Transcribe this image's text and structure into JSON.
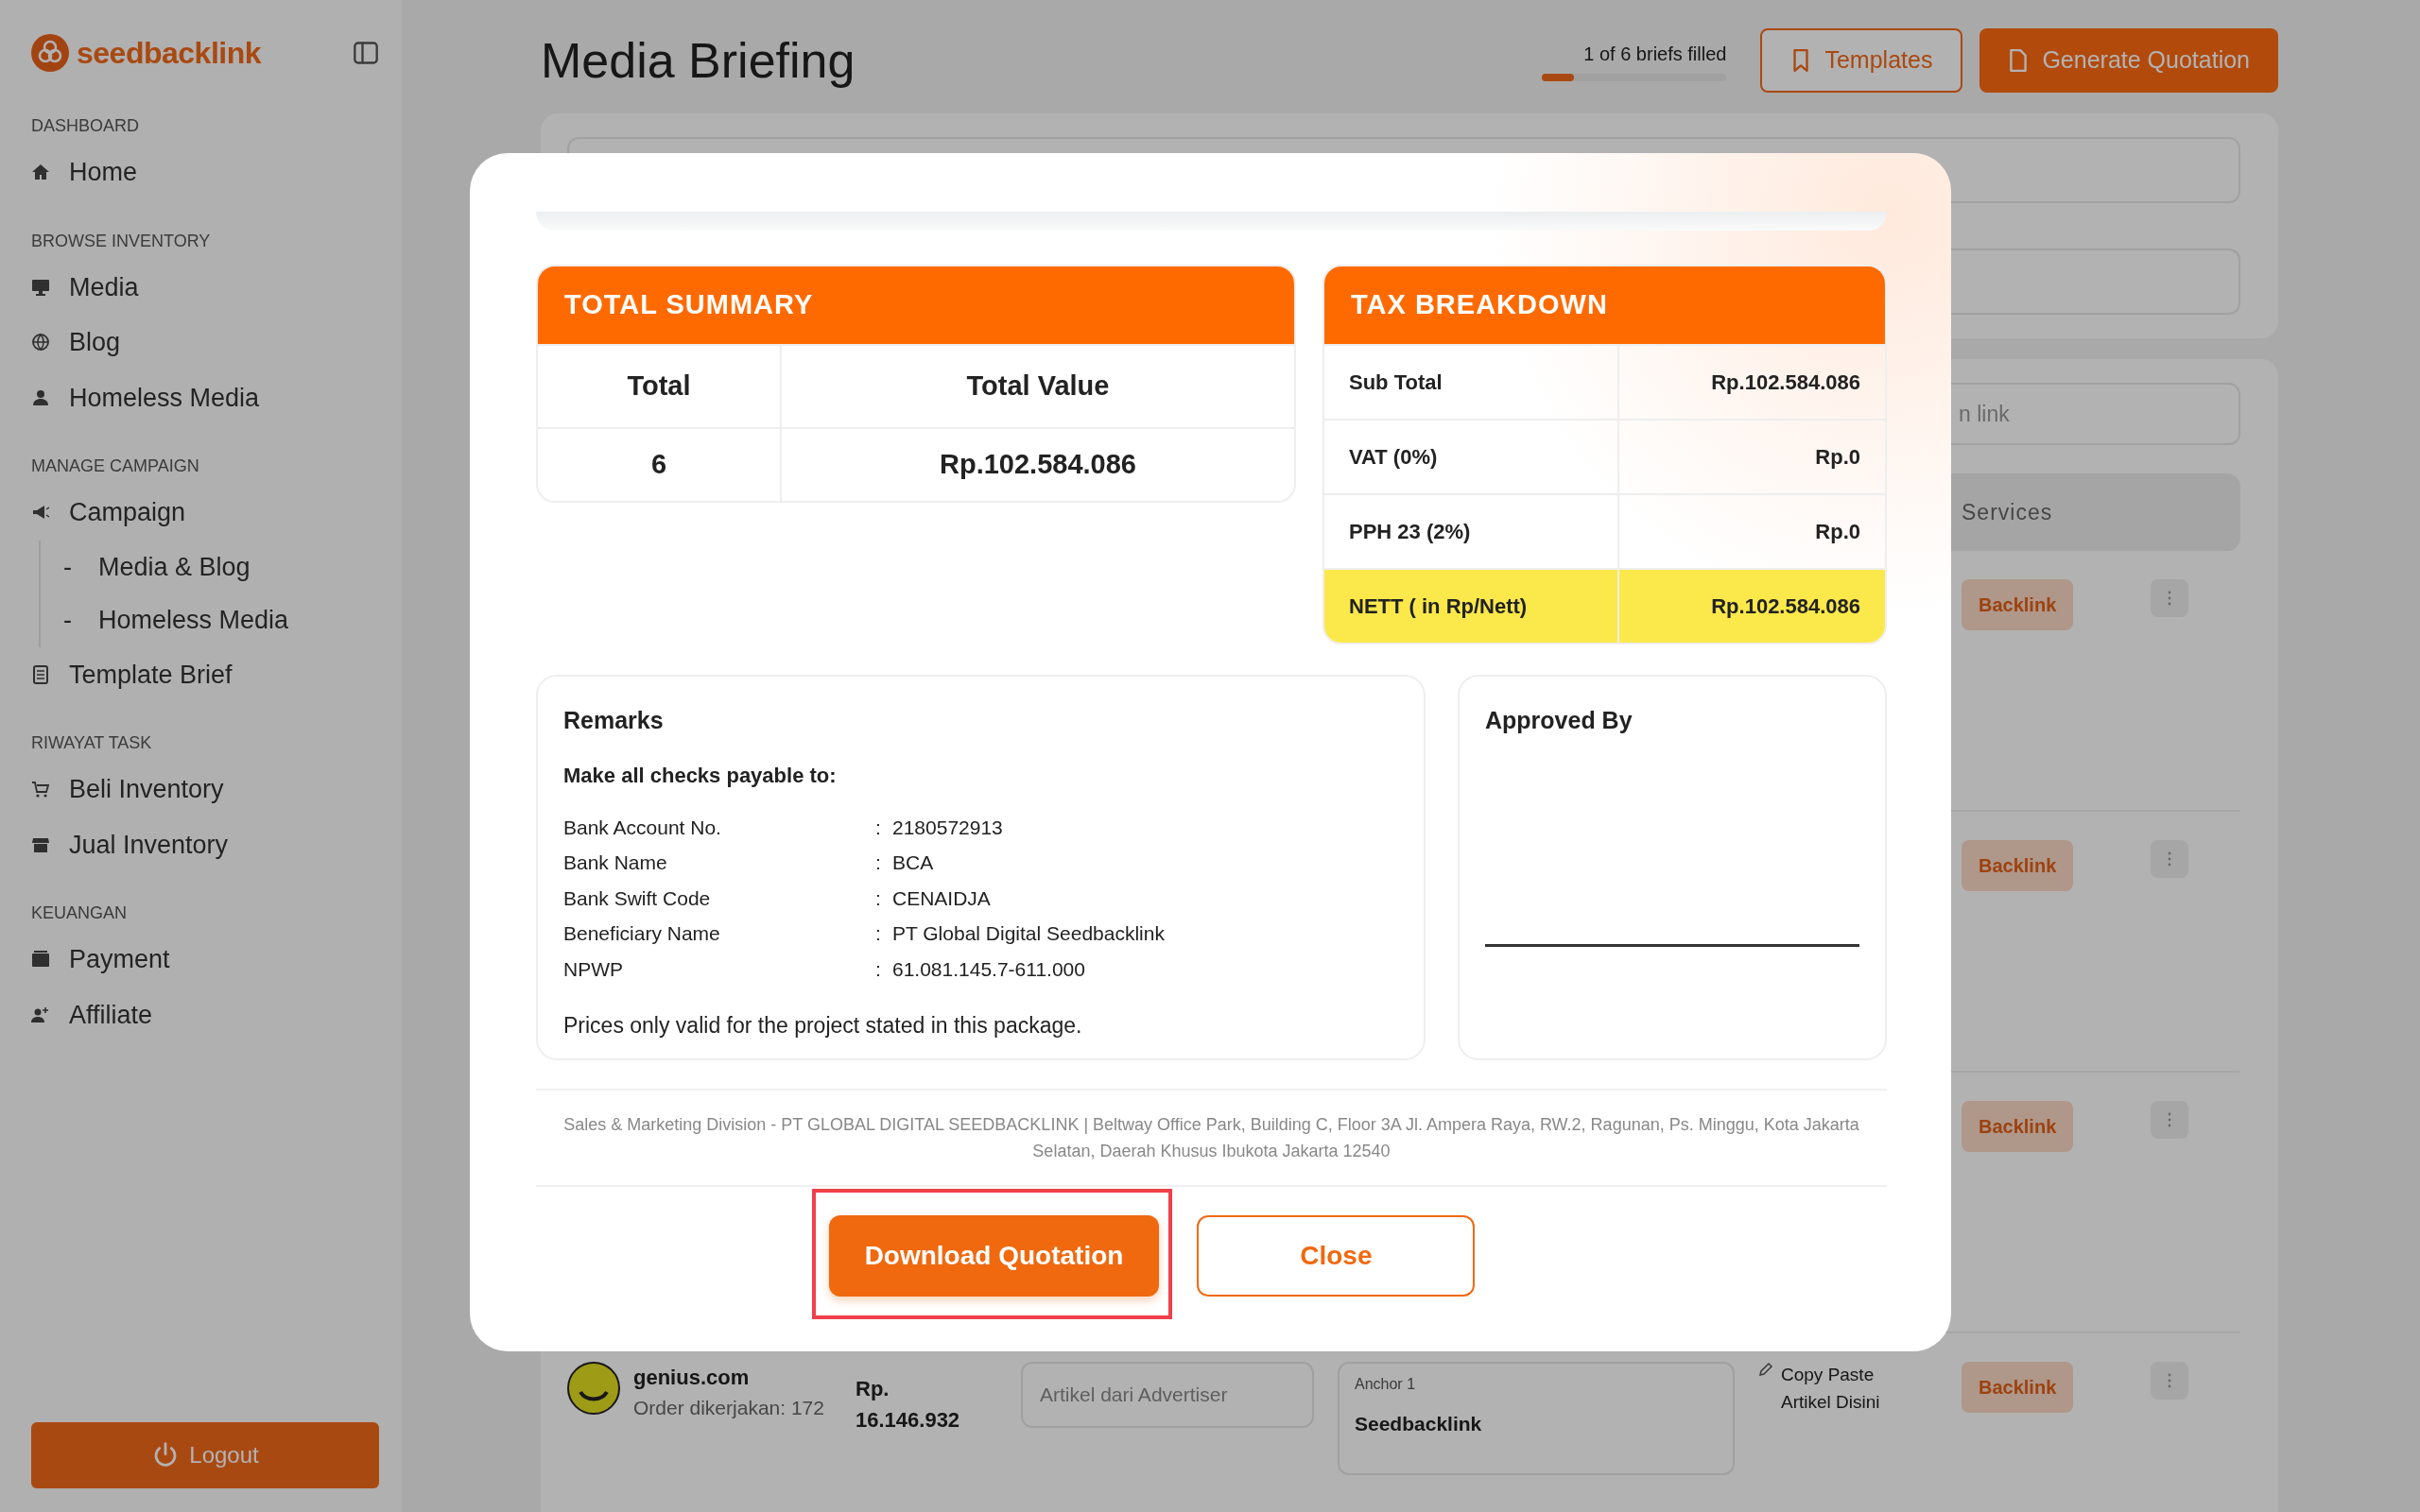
{
  "sidebar": {
    "logo": "seedbacklink",
    "sections": [
      {
        "heading": "DASHBOARD",
        "items": [
          {
            "label": "Home"
          }
        ]
      },
      {
        "heading": "BROWSE INVENTORY",
        "items": [
          {
            "label": "Media"
          },
          {
            "label": "Blog"
          },
          {
            "label": "Homeless Media"
          }
        ]
      },
      {
        "heading": "MANAGE CAMPAIGN",
        "items": [
          {
            "label": "Campaign",
            "children": [
              {
                "marker": "-",
                "label": "Media & Blog"
              },
              {
                "marker": "-",
                "label": "Homeless Media"
              }
            ]
          },
          {
            "label": "Template Brief"
          }
        ]
      },
      {
        "heading": "RIWAYAT TASK",
        "items": [
          {
            "label": "Beli Inventory"
          },
          {
            "label": "Jual Inventory"
          }
        ]
      },
      {
        "heading": "KEUANGAN",
        "items": [
          {
            "label": "Payment"
          },
          {
            "label": "Affiliate"
          }
        ]
      }
    ],
    "logout": "Logout"
  },
  "header": {
    "title": "Media Briefing",
    "progress": {
      "text": "1 of 6 briefs filled",
      "level": 0.17
    },
    "buttons": [
      {
        "label": "Templates",
        "kind": "outline"
      },
      {
        "label": "Generate Quotation",
        "kind": "primary"
      }
    ]
  },
  "background": {
    "search": {
      "placeholder": "n link"
    },
    "table": {
      "columns": [
        "Services"
      ],
      "rows": [
        {
          "service": "Backlink"
        },
        {
          "service": "Backlink"
        },
        {
          "service": "Backlink"
        },
        {
          "media": "genius.com",
          "orders": "Order dikerjakan: 172",
          "price": "Rp. 16.146.932",
          "article": {
            "placeholder": "Artikel dari Advertiser"
          },
          "anchor": {
            "label": "Anchor 1",
            "value": "Seedbacklink"
          },
          "copy_paste": "Copy Paste Artikel Disini",
          "service": "Backlink"
        }
      ]
    }
  },
  "modal": {
    "summary": {
      "title": "TOTAL SUMMARY",
      "columns": [
        "Total",
        "Total Value"
      ],
      "row": [
        "6",
        "Rp.102.584.086"
      ]
    },
    "tax": {
      "title": "TAX BREAKDOWN",
      "rows": [
        {
          "label": "Sub Total",
          "value": "Rp.102.584.086",
          "highlighted": false
        },
        {
          "label": "VAT (0%)",
          "value": "Rp.0",
          "highlighted": false
        },
        {
          "label": "PPH 23 (2%)",
          "value": "Rp.0",
          "highlighted": false
        },
        {
          "label": "NETT ( in Rp/Nett)",
          "value": "Rp.102.584.086",
          "highlighted": true
        }
      ]
    },
    "remarks": {
      "title": "Remarks",
      "subtitle": "Make all checks payable to:",
      "fields": [
        {
          "label": "Bank Account No.",
          "separator": ":",
          "value": "2180572913"
        },
        {
          "label": "Bank Name",
          "separator": ":",
          "value": "BCA"
        },
        {
          "label": "Bank Swift Code",
          "separator": ":",
          "value": "CENAIDJA"
        },
        {
          "label": "Beneficiary Name",
          "separator": ":",
          "value": "PT Global Digital Seedbacklink"
        },
        {
          "label": "NPWP",
          "separator": ":",
          "value": "61.081.145.7-611.000"
        }
      ],
      "note": "Prices only valid for the project stated in this package."
    },
    "approval": {
      "title": "Approved By"
    },
    "footer": "Sales & Marketing Division - PT GLOBAL DIGITAL SEEDBACKLINK | Beltway Office Park, Building C, Floor 3A Jl. Ampera Raya, RW.2, Ragunan, Ps. Minggu, Kota Jakarta Selatan, Daerah Khusus Ibukota Jakarta 12540",
    "buttons": [
      {
        "label": "Download Quotation",
        "kind": "primary",
        "highlighted": true
      },
      {
        "label": "Close",
        "kind": "outline",
        "highlighted": false
      }
    ]
  }
}
